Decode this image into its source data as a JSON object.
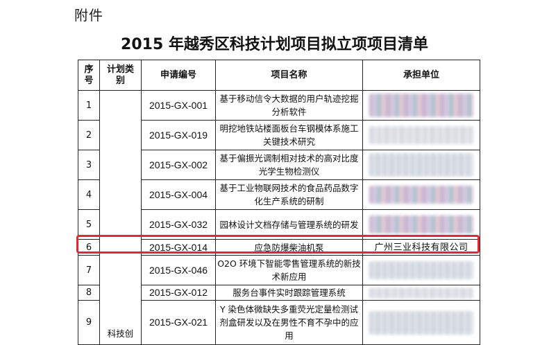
{
  "document": {
    "attachment_label": "附件",
    "title": "2015 年越秀区科技计划项目拟立项项目清单"
  },
  "table": {
    "headers": {
      "no": "序号",
      "type": "计划类别",
      "code": "申请编号",
      "name": "项目名称",
      "unit": "承担单位"
    },
    "type_value": "科技创",
    "rows": [
      {
        "no": "1",
        "code": "2015-GX-001",
        "name": "基于移动信令大数据的用户轨迹挖掘分析软件",
        "unit": ""
      },
      {
        "no": "2",
        "code": "2015-GX-019",
        "name": "明挖地铁站楼面板台车钢模体系施工关键技术研究",
        "unit": ""
      },
      {
        "no": "3",
        "code": "2015-GX-002",
        "name": "基于偏振光调制相对技术的高对比度光学生物检测仪",
        "unit": ""
      },
      {
        "no": "4",
        "code": "2015-GX-004",
        "name": "基于工业物联网技术的食品药品数字化生产系统的研制",
        "unit": ""
      },
      {
        "no": "5",
        "code": "2015-GX-032",
        "name": "园林设计文档存储与管理系统的研发",
        "unit": ""
      },
      {
        "no": "6",
        "code": "2015-GX-014",
        "name": "应急防爆柴油机泵",
        "unit": "广州三业科技有限公司"
      },
      {
        "no": "7",
        "code": "2015-GX-046",
        "name": "O2O 环境下智能零售管理系统的新技术新应用",
        "unit": ""
      },
      {
        "no": "8",
        "code": "2015-GX-012",
        "name": "服务台事件实时跟踪管理系统",
        "unit": ""
      },
      {
        "no": "9",
        "code": "2015-GX-021",
        "name": "Y 染色体微缺失多重荧光定量检测试剂盒研发以及在男性不育不孕中的应用",
        "unit": ""
      }
    ]
  }
}
